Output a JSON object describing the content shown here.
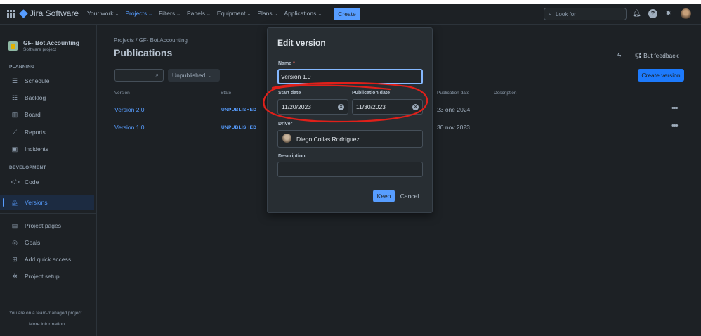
{
  "topnav": {
    "app_name": "Jira Software",
    "items": [
      {
        "label": "Your work",
        "active": false
      },
      {
        "label": "Projects",
        "active": true
      },
      {
        "label": "Filters",
        "active": false
      },
      {
        "label": "Panels",
        "active": false
      },
      {
        "label": "Equipment",
        "active": false
      },
      {
        "label": "Plans",
        "active": false
      },
      {
        "label": "Applications",
        "active": false
      }
    ],
    "create_label": "Create",
    "search_placeholder": "Look for"
  },
  "sidebar": {
    "project_name": "GF- Bot Accounting",
    "project_type": "Software project",
    "planning_header": "PLANNING",
    "planning_items": [
      {
        "label": "Schedule",
        "icon": "timeline-icon"
      },
      {
        "label": "Backlog",
        "icon": "backlog-icon"
      },
      {
        "label": "Board",
        "icon": "board-icon"
      },
      {
        "label": "Reports",
        "icon": "reports-icon"
      },
      {
        "label": "Incidents",
        "icon": "incidents-icon"
      }
    ],
    "development_header": "DEVELOPMENT",
    "development_items": [
      {
        "label": "Code",
        "icon": "code-icon"
      },
      {
        "label": "Versions",
        "icon": "versions-icon",
        "active": true
      }
    ],
    "other_items": [
      {
        "label": "Project pages",
        "icon": "page-icon"
      },
      {
        "label": "Goals",
        "icon": "goals-icon"
      },
      {
        "label": "Add quick access",
        "icon": "add-shortcut-icon"
      },
      {
        "label": "Project setup",
        "icon": "gear-icon"
      }
    ],
    "footer_text": "You are on a team-managed project",
    "footer_link": "More information"
  },
  "main": {
    "breadcrumb": "Projects  /  GF- Bot Accounting",
    "title": "Publications",
    "filter_select": "Unpublished",
    "give_feedback": "But feedback",
    "create_version": "Create version",
    "columns": {
      "version": "Version",
      "state": "State",
      "publication_date": "Publication date",
      "description": "Description"
    },
    "rows": [
      {
        "version": "Version 2.0",
        "state": "UNPUBLISHED",
        "publication_date": "23 one 2024"
      },
      {
        "version": "Version 1.0",
        "state": "UNPUBLISHED",
        "publication_date": "30 nov 2023"
      }
    ]
  },
  "modal": {
    "title": "Edit version",
    "name_label": "Name",
    "name_required": "*",
    "name_value": "Versión 1.0",
    "start_label": "Start date",
    "start_value": "11/20/2023",
    "publication_label": "Publication date",
    "publication_value": "11/30/2023",
    "driver_label": "Driver",
    "driver_value": "Diego Collas Rodríguez",
    "description_label": "Description",
    "description_value": "",
    "keep_label": "Keep",
    "cancel_label": "Cancel"
  },
  "colors": {
    "background": "#1d2125",
    "accent": "#579dff",
    "annotation": "#e0201a"
  }
}
